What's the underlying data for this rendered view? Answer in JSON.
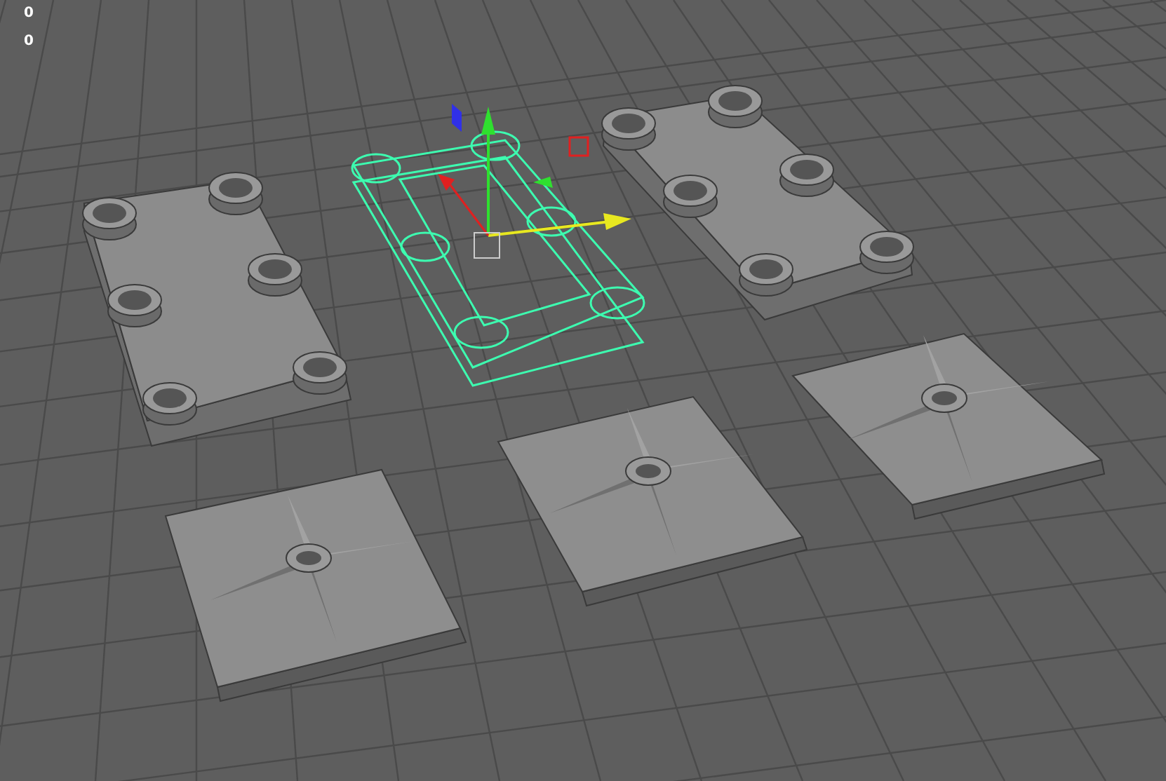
{
  "viewport": {
    "hud_values": [
      "0",
      "0"
    ]
  }
}
